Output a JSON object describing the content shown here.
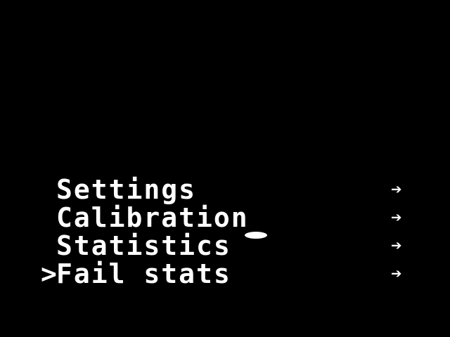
{
  "menu": {
    "cursor_symbol": ">",
    "selected_index": 3,
    "items": [
      {
        "label": "Settings",
        "arrow": "➔",
        "arrow_icon": "arrow-right-icon"
      },
      {
        "label": "Calibration",
        "arrow": "➔",
        "arrow_icon": "arrow-right-icon"
      },
      {
        "label": "Statistics",
        "arrow": "➔",
        "arrow_icon": "arrow-right-icon"
      },
      {
        "label": "Fail stats",
        "arrow": "➔",
        "arrow_icon": "arrow-right-icon"
      }
    ]
  },
  "colors": {
    "background": "#000000",
    "foreground": "#ffffff"
  }
}
